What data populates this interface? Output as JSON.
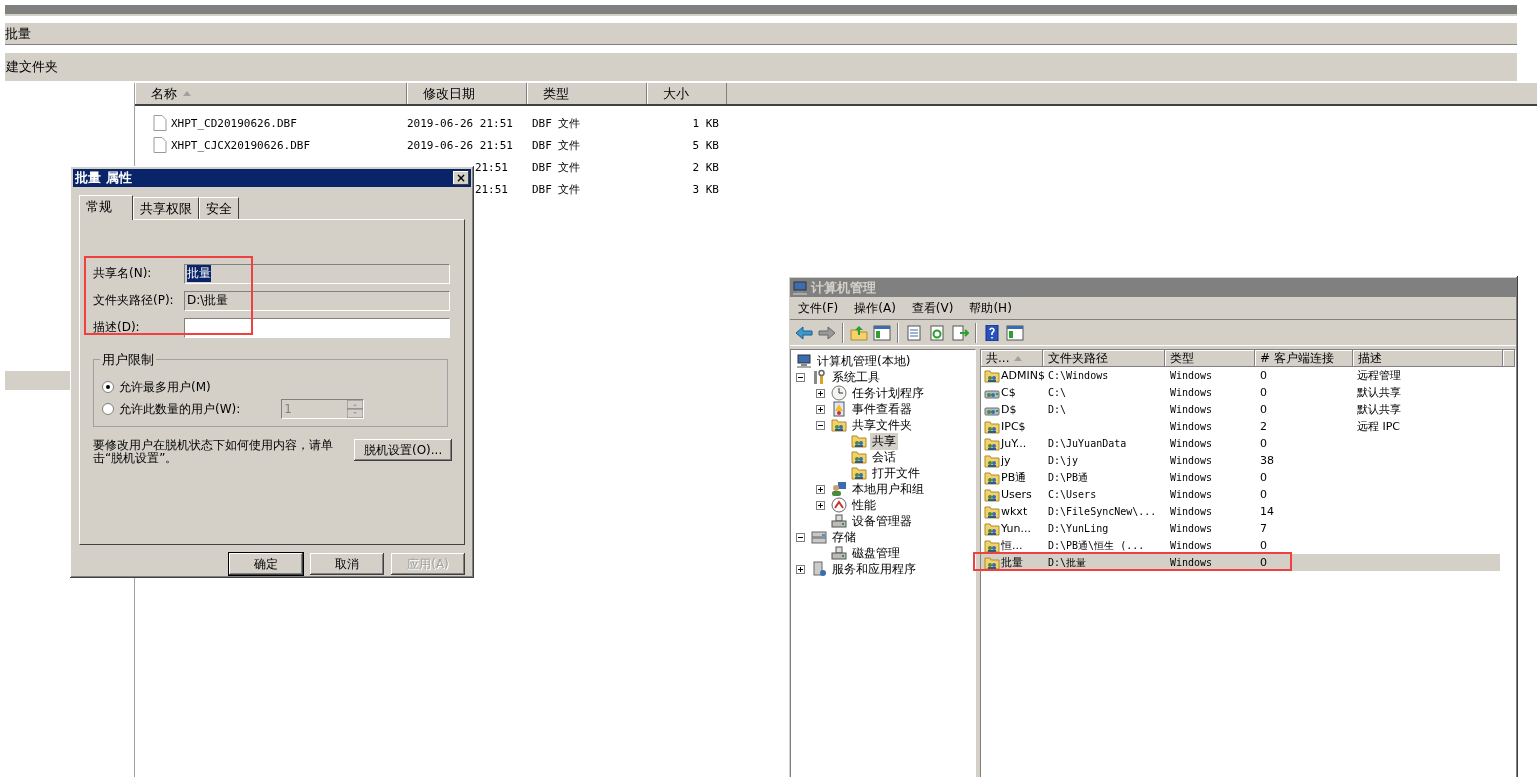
{
  "explorer": {
    "address": "批量",
    "toolbar_button": "建文件夹",
    "nav_selected": true,
    "columns": [
      {
        "label": "名称",
        "sorted": true
      },
      {
        "label": "修改日期",
        "sorted": false
      },
      {
        "label": "类型",
        "sorted": false
      },
      {
        "label": "大小",
        "sorted": false
      }
    ],
    "files": [
      {
        "name": "XHPT_CD20190626.DBF",
        "modified": "2019-06-26 21:51",
        "type": "DBF 文件",
        "size": "1 KB"
      },
      {
        "name": "XHPT_CJCX20190626.DBF",
        "modified": "2019-06-26 21:51",
        "type": "DBF 文件",
        "size": "5 KB"
      },
      {
        "modified": "21:51",
        "type": "DBF 文件",
        "size": "2 KB"
      },
      {
        "modified": "21:51",
        "type": "DBF 文件",
        "size": "3 KB"
      }
    ]
  },
  "dialog": {
    "title": "批量 属性",
    "close": "×",
    "tabs": [
      {
        "label": "常规",
        "selected": true
      },
      {
        "label": "共享权限",
        "selected": false
      },
      {
        "label": "安全",
        "selected": false
      }
    ],
    "marked": true,
    "fields": [
      {
        "label": "共享名(N):",
        "value": "批量",
        "readonly": true,
        "text_selected": true
      },
      {
        "label": "文件夹路径(P):",
        "value": "D:\\批量",
        "readonly": true,
        "text_selected": false
      },
      {
        "label": "描述(D):",
        "readonly": false
      }
    ],
    "user_limit": {
      "title": "用户限制",
      "options": [
        {
          "label": "允许最多用户(M)",
          "selected": true
        },
        {
          "label": "允许此数量的用户(W):",
          "selected": false
        }
      ],
      "count": "1",
      "count_disabled": true
    },
    "offline_text": "要修改用户在脱机状态下如何使用内容，请单击“脱机设置”。",
    "offline_button": "脱机设置(O)...",
    "buttons": [
      {
        "label": "确定",
        "default": true,
        "disabled": false
      },
      {
        "label": "取消",
        "default": false,
        "disabled": false
      },
      {
        "label": "应用(A)",
        "default": false,
        "disabled": true
      }
    ]
  },
  "computer_management": {
    "title": "计算机管理",
    "menu": [
      "文件(F)",
      "操作(A)",
      "查看(V)",
      "帮助(H)"
    ],
    "toolbar": [
      {
        "kind": "back"
      },
      {
        "kind": "forward"
      },
      {
        "kind": "separator"
      },
      {
        "kind": "up"
      },
      {
        "kind": "pane"
      },
      {
        "kind": "separator"
      },
      {
        "kind": "properties"
      },
      {
        "kind": "refresh"
      },
      {
        "kind": "export"
      },
      {
        "kind": "separator"
      },
      {
        "kind": "help"
      },
      {
        "kind": "pane"
      }
    ],
    "tree": [
      {
        "label": "计算机管理(本地)",
        "kind": "computer",
        "selected": false,
        "children": [
          {
            "label": "系统工具",
            "kind": "tools",
            "expanded": true,
            "selected": false,
            "children": [
              {
                "label": "任务计划程序",
                "kind": "clock",
                "expanded": false,
                "selected": false
              },
              {
                "label": "事件查看器",
                "kind": "log",
                "expanded": false,
                "selected": false
              },
              {
                "label": "共享文件夹",
                "kind": "folder",
                "expanded": true,
                "selected": false,
                "children": [
                  {
                    "label": "共享",
                    "kind": "folder",
                    "selected": true
                  },
                  {
                    "label": "会话",
                    "kind": "folder",
                    "selected": false
                  },
                  {
                    "label": "打开文件",
                    "kind": "folder",
                    "selected": false
                  }
                ]
              },
              {
                "label": "本地用户和组",
                "kind": "users",
                "expanded": false,
                "selected": false
              },
              {
                "label": "性能",
                "kind": "gauge",
                "expanded": false,
                "selected": false
              },
              {
                "label": "设备管理器",
                "kind": "device",
                "selected": false
              }
            ]
          },
          {
            "label": "存储",
            "kind": "storage",
            "expanded": true,
            "selected": false,
            "children": [
              {
                "label": "磁盘管理",
                "kind": "device",
                "selected": false
              }
            ]
          },
          {
            "label": "服务和应用程序",
            "kind": "services",
            "expanded": false,
            "selected": false
          }
        ]
      }
    ],
    "columns": [
      {
        "label": "共...",
        "sorted": true
      },
      {
        "label": "文件夹路径",
        "sorted": false
      },
      {
        "label": "类型",
        "sorted": false
      },
      {
        "label": "# 客户端连接",
        "sorted": false
      },
      {
        "label": "描述",
        "sorted": false
      }
    ],
    "shares": [
      {
        "name": "ADMIN$",
        "path": "C:\\Windows",
        "type": "Windows",
        "clients": "0",
        "description": "远程管理",
        "kind": "folder",
        "selected": false,
        "marked": false
      },
      {
        "name": "C$",
        "path": "C:\\",
        "type": "Windows",
        "clients": "0",
        "description": "默认共享",
        "kind": "drive",
        "selected": false,
        "marked": false
      },
      {
        "name": "D$",
        "path": "D:\\",
        "type": "Windows",
        "clients": "0",
        "description": "默认共享",
        "kind": "drive",
        "selected": false,
        "marked": false
      },
      {
        "name": "IPC$",
        "type": "Windows",
        "clients": "2",
        "description": "远程 IPC",
        "kind": "folder",
        "selected": false,
        "marked": false
      },
      {
        "name": "JuY...",
        "path": "D:\\JuYuanData",
        "type": "Windows",
        "clients": "0",
        "kind": "folder",
        "selected": false,
        "marked": false
      },
      {
        "name": "jy",
        "path": "D:\\jy",
        "type": "Windows",
        "clients": "38",
        "kind": "folder",
        "selected": false,
        "marked": false
      },
      {
        "name": "PB通",
        "path": "D:\\PB通",
        "type": "Windows",
        "clients": "0",
        "kind": "folder",
        "selected": false,
        "marked": false
      },
      {
        "name": "Users",
        "path": "C:\\Users",
        "type": "Windows",
        "clients": "0",
        "kind": "folder",
        "selected": false,
        "marked": false
      },
      {
        "name": "wkxt",
        "path": "D:\\FileSyncNew\\...",
        "type": "Windows",
        "clients": "14",
        "kind": "folder",
        "selected": false,
        "marked": false
      },
      {
        "name": "Yun...",
        "path": "D:\\YunLing",
        "type": "Windows",
        "clients": "7",
        "kind": "folder",
        "selected": false,
        "marked": false
      },
      {
        "name": "恒...",
        "path": "D:\\PB通\\恒生 (...",
        "type": "Windows",
        "clients": "0",
        "kind": "folder",
        "selected": false,
        "marked": false
      },
      {
        "name": "批量",
        "path": "D:\\批量",
        "type": "Windows",
        "clients": "0",
        "kind": "folder",
        "selected": true,
        "marked": true
      }
    ]
  }
}
